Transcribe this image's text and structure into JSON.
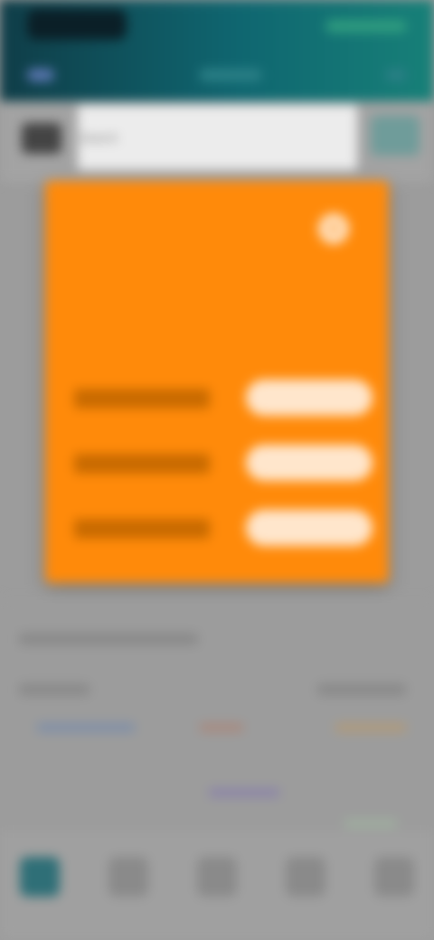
{
  "status": {
    "time": "",
    "icons": ""
  },
  "search": {
    "placeholder": "Search"
  },
  "modal": {
    "title": "",
    "subtitle": "",
    "close_label": "×",
    "options": [
      {
        "label": "",
        "button": ""
      },
      {
        "label": "",
        "button": ""
      },
      {
        "label": "",
        "button": ""
      }
    ]
  },
  "content": {
    "section_title": "",
    "rows": [
      {
        "left": "",
        "right": ""
      },
      {
        "left": "",
        "right": ""
      },
      {
        "left": "",
        "right": ""
      }
    ]
  },
  "bottom_nav": [
    {
      "label": "",
      "icon": "home-icon",
      "active": true
    },
    {
      "label": "",
      "icon": "calendar-icon",
      "active": false
    },
    {
      "label": "",
      "icon": "plus-icon",
      "active": false
    },
    {
      "label": "",
      "icon": "chart-icon",
      "active": false
    },
    {
      "label": "",
      "icon": "profile-icon",
      "active": false
    }
  ],
  "colors": {
    "header_start": "#0f3d48",
    "header_end": "#178078",
    "modal_bg": "#ff8a0a",
    "overlay": "#9c9c9c"
  }
}
